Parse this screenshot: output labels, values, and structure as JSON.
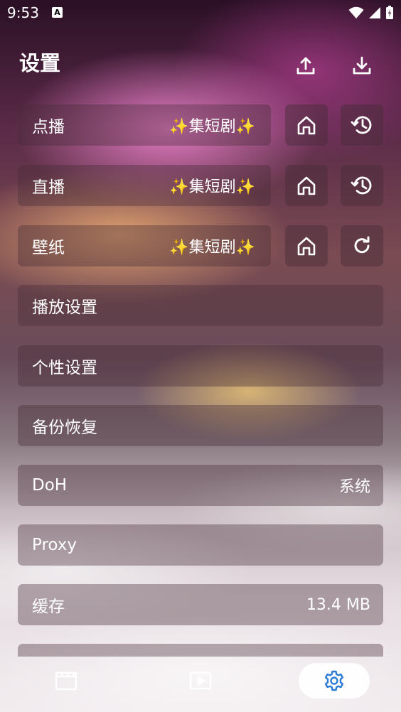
{
  "status_bar": {
    "time": "9:53",
    "notification_glyph": "A"
  },
  "header": {
    "title": "设置",
    "upload_icon": "upload-icon",
    "download_icon": "download-icon"
  },
  "rows": {
    "vod": {
      "label": "点播",
      "value": "✨集短剧✨"
    },
    "live": {
      "label": "直播",
      "value": "✨集短剧✨"
    },
    "wallpaper": {
      "label": "壁纸",
      "value": "✨集短剧✨"
    },
    "playback": {
      "label": "播放设置"
    },
    "personal": {
      "label": "个性设置"
    },
    "backup": {
      "label": "备份恢复"
    },
    "doh": {
      "label": "DoH",
      "value": "系统"
    },
    "proxy": {
      "label": "Proxy"
    },
    "cache": {
      "label": "缓存",
      "value": "13.4 MB"
    }
  },
  "side_buttons": {
    "home_icon": "home-icon",
    "history_icon": "history-icon",
    "refresh_icon": "refresh-icon"
  },
  "bottom_nav": {
    "items": [
      "movie-clapper-icon",
      "video-play-icon",
      "settings-gear-icon"
    ],
    "active_index": 2
  },
  "colors": {
    "accent": "#2b7bd6",
    "row_background": "rgba(70,45,55,0.38)"
  }
}
